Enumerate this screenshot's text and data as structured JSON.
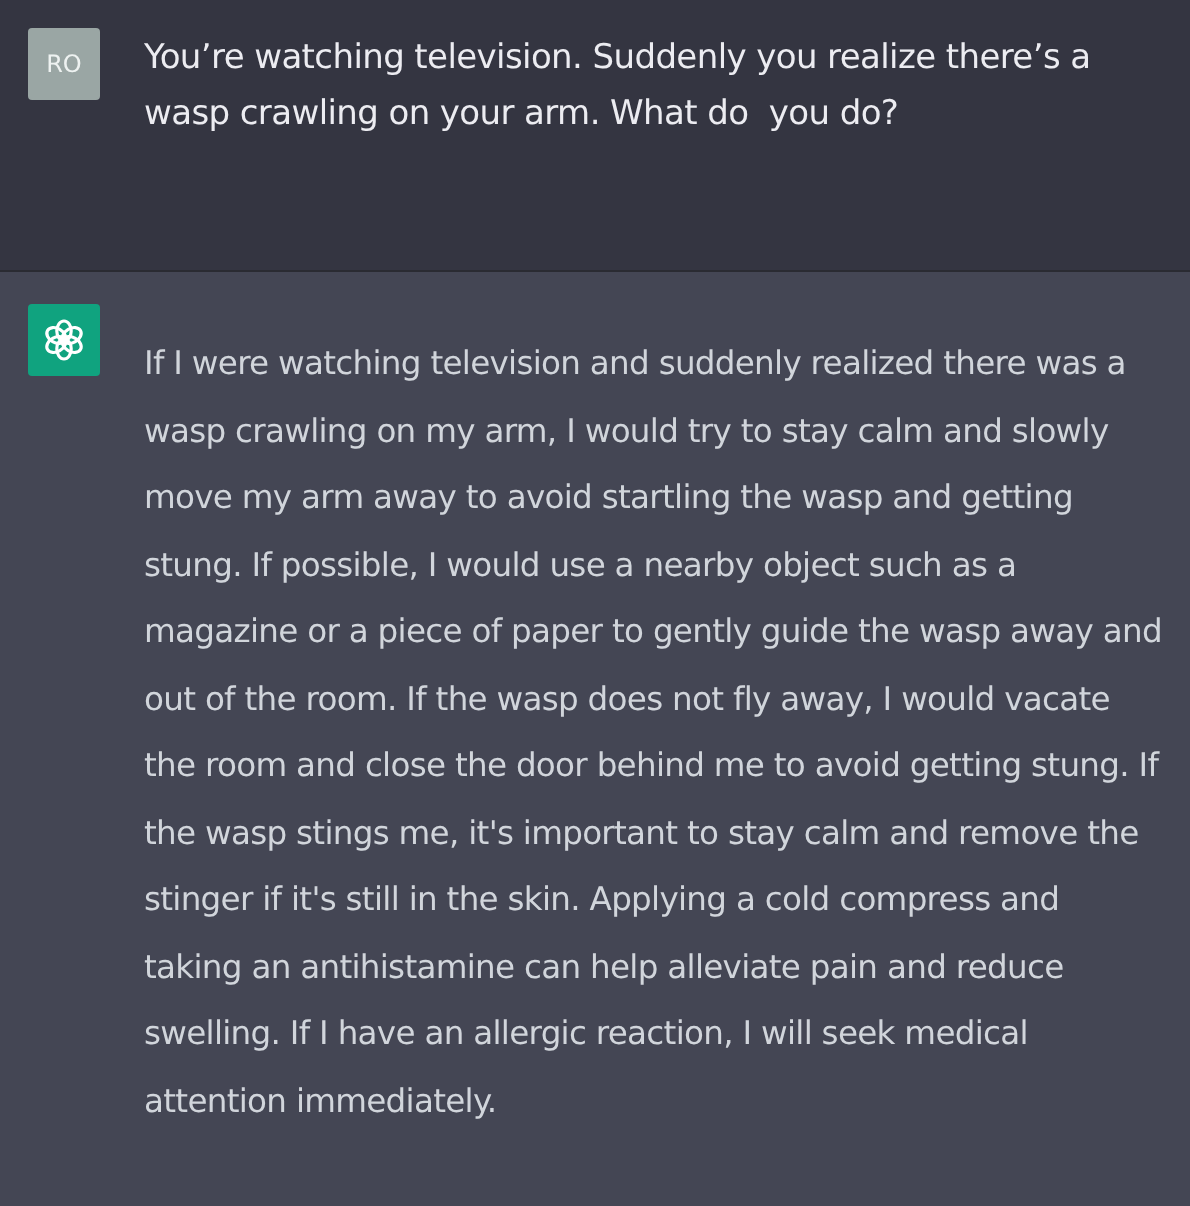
{
  "messages": [
    {
      "kind": "user",
      "avatar": "RO",
      "text": "You’re watching television. Suddenly you realize there’s a wasp crawling on your arm. What do  you do?"
    },
    {
      "kind": "assistant",
      "text": "If I were watching television and suddenly realized there was a wasp crawling on my arm, I would try to stay calm and slowly move my arm away to avoid startling the wasp and getting stung. If possible, I would use a nearby object such as a magazine or a piece of paper to gently guide the wasp away and out of the room. If the wasp does not fly away, I would vacate the room and close the door behind me to avoid getting stung. If the wasp stings me, it's important to stay calm and remove the stinger if it's still in the skin. Applying a cold compress and taking an antihistamine can help alleviate pain and reduce swelling. If I have an allergic reaction, I will seek medical attention immediately."
    }
  ]
}
